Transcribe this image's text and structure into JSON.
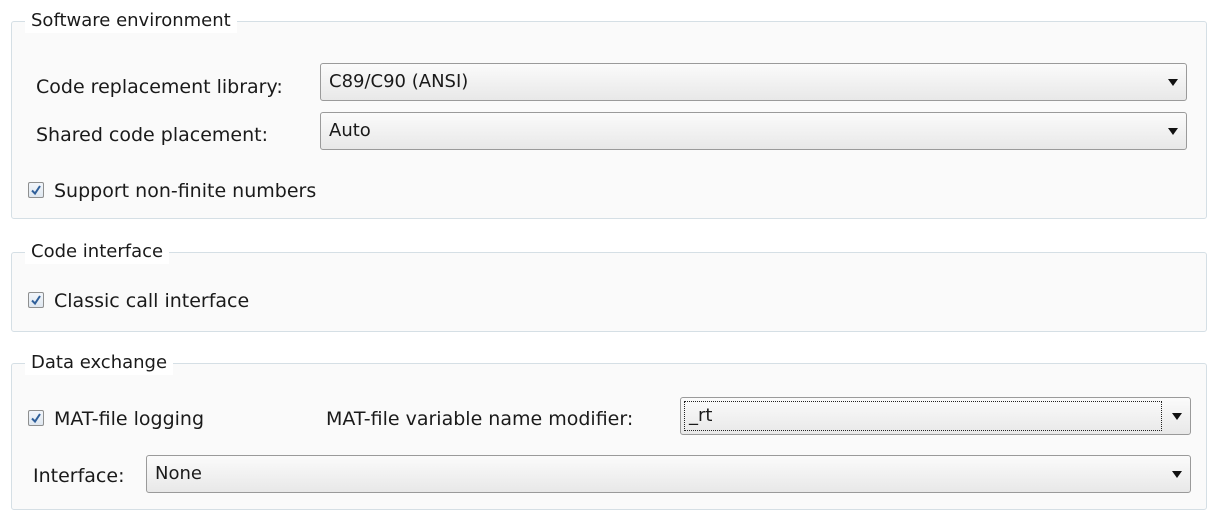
{
  "software_environment": {
    "title": "Software environment",
    "code_replacement_library": {
      "label": "Code replacement library:",
      "value": "C89/C90 (ANSI)"
    },
    "shared_code_placement": {
      "label": "Shared code placement:",
      "value": "Auto"
    },
    "support_non_finite": {
      "label": "Support non-finite numbers",
      "checked": true
    }
  },
  "code_interface": {
    "title": "Code interface",
    "classic_call_interface": {
      "label": "Classic call interface",
      "checked": true
    }
  },
  "data_exchange": {
    "title": "Data exchange",
    "mat_file_logging": {
      "label": "MAT-file logging",
      "checked": true
    },
    "mat_file_modifier": {
      "label": "MAT-file variable name modifier:",
      "value": "_rt"
    },
    "interface": {
      "label": "Interface:",
      "value": "None"
    }
  },
  "icons": {
    "checkbox": "checkmark-icon",
    "dropdown": "chevron-down-icon"
  },
  "colors": {
    "checkmark": "#2f5f9a",
    "group_border": "#d5dfe5"
  }
}
